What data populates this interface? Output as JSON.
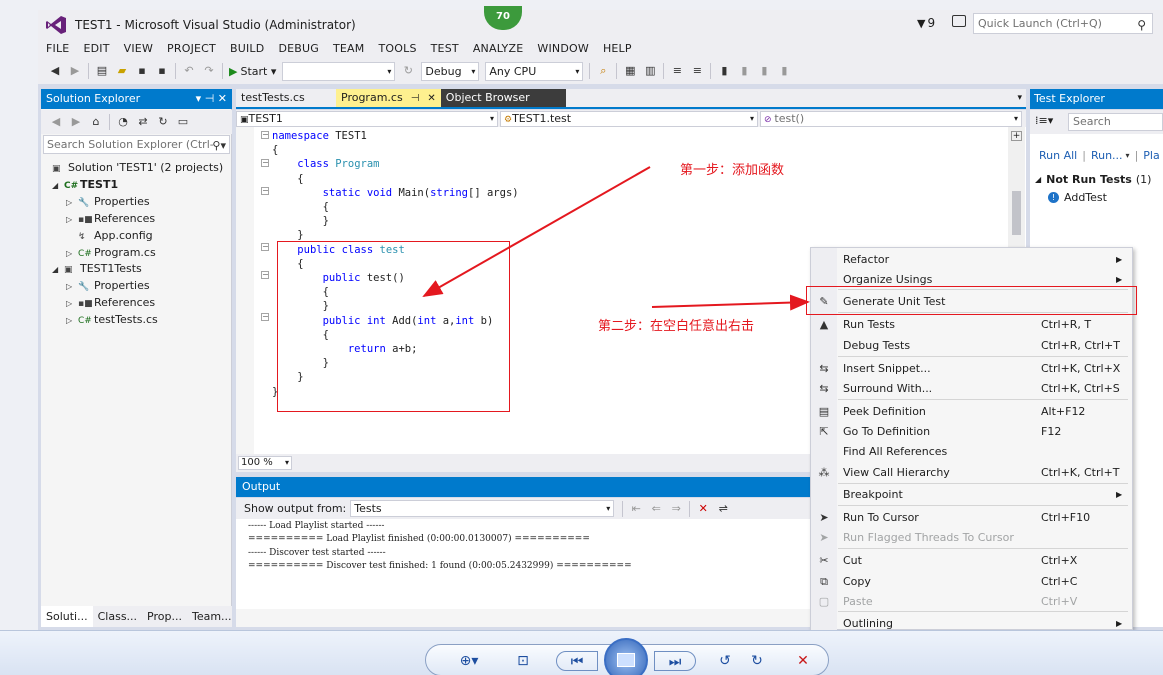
{
  "window": {
    "title": "TEST1 - Microsoft Visual Studio (Administrator)",
    "notification_count": "70",
    "flag_count": "9",
    "quick_launch_placeholder": "Quick Launch (Ctrl+Q)"
  },
  "menu": [
    "FILE",
    "EDIT",
    "VIEW",
    "PROJECT",
    "BUILD",
    "DEBUG",
    "TEAM",
    "TOOLS",
    "TEST",
    "ANALYZE",
    "WINDOW",
    "HELP"
  ],
  "toolbar": {
    "start_label": "Start",
    "config": "Debug",
    "platform": "Any CPU"
  },
  "solution_explorer": {
    "title": "Solution Explorer",
    "search_placeholder": "Search Solution Explorer (Ctrl-",
    "tree": [
      {
        "label": "Solution 'TEST1' (2 projects)",
        "icon": "solution-icon"
      },
      {
        "label": "TEST1",
        "icon": "csharp-project-icon"
      },
      {
        "label": "Properties",
        "icon": "wrench-icon"
      },
      {
        "label": "References",
        "icon": "references-icon"
      },
      {
        "label": "App.config",
        "icon": "config-file-icon"
      },
      {
        "label": "Program.cs",
        "icon": "csharp-file-icon"
      },
      {
        "label": "TEST1Tests",
        "icon": "test-project-icon"
      },
      {
        "label": "Properties",
        "icon": "wrench-icon"
      },
      {
        "label": "References",
        "icon": "references-icon"
      },
      {
        "label": "testTests.cs",
        "icon": "csharp-file-icon"
      }
    ],
    "bottom_tabs": [
      "Soluti...",
      "Class...",
      "Prop...",
      "Team..."
    ]
  },
  "editor": {
    "tabs": [
      {
        "label": "testTests.cs"
      },
      {
        "label": "Program.cs"
      },
      {
        "label": "Object Browser"
      }
    ],
    "nav": {
      "project": "TEST1",
      "class": "TEST1.test",
      "member": "test()"
    },
    "zoom": "100 %"
  },
  "code": [
    [
      {
        "t": "namespace",
        "c": "kw"
      },
      {
        "t": " TEST1"
      }
    ],
    [
      {
        "t": "{"
      }
    ],
    [
      {
        "t": "    "
      },
      {
        "t": "class",
        "c": "kw"
      },
      {
        "t": " "
      },
      {
        "t": "Program",
        "c": "ty"
      }
    ],
    [
      {
        "t": "    {"
      }
    ],
    [
      {
        "t": "        "
      },
      {
        "t": "static",
        "c": "kw"
      },
      {
        "t": " "
      },
      {
        "t": "void",
        "c": "kw"
      },
      {
        "t": " Main("
      },
      {
        "t": "string",
        "c": "kw"
      },
      {
        "t": "[] args)"
      }
    ],
    [
      {
        "t": "        {"
      }
    ],
    [
      {
        "t": "        }"
      }
    ],
    [
      {
        "t": "    }"
      }
    ],
    [
      {
        "t": "    "
      },
      {
        "t": "public",
        "c": "kw"
      },
      {
        "t": " "
      },
      {
        "t": "class",
        "c": "kw"
      },
      {
        "t": " "
      },
      {
        "t": "test",
        "c": "ty"
      }
    ],
    [
      {
        "t": "    {"
      }
    ],
    [
      {
        "t": "        "
      },
      {
        "t": "public",
        "c": "kw"
      },
      {
        "t": " test()"
      }
    ],
    [
      {
        "t": "        {"
      }
    ],
    [
      {
        "t": "        }"
      }
    ],
    [
      {
        "t": "        "
      },
      {
        "t": "public",
        "c": "kw"
      },
      {
        "t": " "
      },
      {
        "t": "int",
        "c": "kw"
      },
      {
        "t": " Add("
      },
      {
        "t": "int",
        "c": "kw"
      },
      {
        "t": " a,"
      },
      {
        "t": "int",
        "c": "kw"
      },
      {
        "t": " b)"
      }
    ],
    [
      {
        "t": "        {"
      }
    ],
    [
      {
        "t": "            "
      },
      {
        "t": "return",
        "c": "kw"
      },
      {
        "t": " a+b;"
      }
    ],
    [
      {
        "t": "        }"
      }
    ],
    [
      {
        "t": "    }"
      }
    ],
    [
      {
        "t": "}"
      }
    ]
  ],
  "output": {
    "title": "Output",
    "show_from_label": "Show output from:",
    "source": "Tests",
    "lines": [
      "------ Load Playlist started ------",
      "========== Load Playlist finished (0:00:00.0130007) ==========",
      "------ Discover test started ------",
      "========== Discover test finished: 1 found (0:00:05.2432999) =========="
    ]
  },
  "test_explorer": {
    "title": "Test Explorer",
    "search_placeholder": "Search",
    "run_all": "Run All",
    "run": "Run...",
    "playlist": "Pla",
    "group_label": "Not Run Tests",
    "group_count": "(1)",
    "test_name": "AddTest"
  },
  "context_menu": [
    {
      "label": "Refactor",
      "shortcut": "",
      "submenu": true,
      "icon": "",
      "disabled": false
    },
    {
      "label": "Organize Usings",
      "shortcut": "",
      "submenu": true,
      "icon": "",
      "disabled": false
    },
    {
      "label": "Generate Unit Test",
      "shortcut": "",
      "submenu": false,
      "icon": "pencil-icon",
      "disabled": false
    },
    {
      "label": "Run Tests",
      "shortcut": "Ctrl+R, T",
      "submenu": false,
      "icon": "run-tests-icon",
      "disabled": false
    },
    {
      "label": "Debug Tests",
      "shortcut": "Ctrl+R, Ctrl+T",
      "submenu": false,
      "icon": "",
      "disabled": false
    },
    {
      "label": "Insert Snippet...",
      "shortcut": "Ctrl+K, Ctrl+X",
      "submenu": false,
      "icon": "snippet-icon",
      "disabled": false
    },
    {
      "label": "Surround With...",
      "shortcut": "Ctrl+K, Ctrl+S",
      "submenu": false,
      "icon": "surround-icon",
      "disabled": false
    },
    {
      "label": "Peek Definition",
      "shortcut": "Alt+F12",
      "submenu": false,
      "icon": "peek-icon",
      "disabled": false
    },
    {
      "label": "Go To Definition",
      "shortcut": "F12",
      "submenu": false,
      "icon": "goto-icon",
      "disabled": false
    },
    {
      "label": "Find All References",
      "shortcut": "",
      "submenu": false,
      "icon": "",
      "disabled": false
    },
    {
      "label": "View Call Hierarchy",
      "shortcut": "Ctrl+K, Ctrl+T",
      "submenu": false,
      "icon": "hierarchy-icon",
      "disabled": false
    },
    {
      "label": "Breakpoint",
      "shortcut": "",
      "submenu": true,
      "icon": "",
      "disabled": false
    },
    {
      "label": "Run To Cursor",
      "shortcut": "Ctrl+F10",
      "submenu": false,
      "icon": "cursor-icon",
      "disabled": false
    },
    {
      "label": "Run Flagged Threads To Cursor",
      "shortcut": "",
      "submenu": false,
      "icon": "flag-cursor-icon",
      "disabled": true
    },
    {
      "label": "Cut",
      "shortcut": "Ctrl+X",
      "submenu": false,
      "icon": "scissors-icon",
      "disabled": false
    },
    {
      "label": "Copy",
      "shortcut": "Ctrl+C",
      "submenu": false,
      "icon": "copy-icon",
      "disabled": false
    },
    {
      "label": "Paste",
      "shortcut": "Ctrl+V",
      "submenu": false,
      "icon": "paste-icon",
      "disabled": true
    },
    {
      "label": "Outlining",
      "shortcut": "",
      "submenu": true,
      "icon": "",
      "disabled": false
    }
  ],
  "annotations": {
    "step1": "第一步：添加函数",
    "step2": "第二步：在空白任意出右击",
    "color": "#e4181f"
  },
  "colors": {
    "accent": "#007acc",
    "keyword": "#0000ff",
    "type": "#2b91af",
    "active_tab": "#fef08f"
  }
}
